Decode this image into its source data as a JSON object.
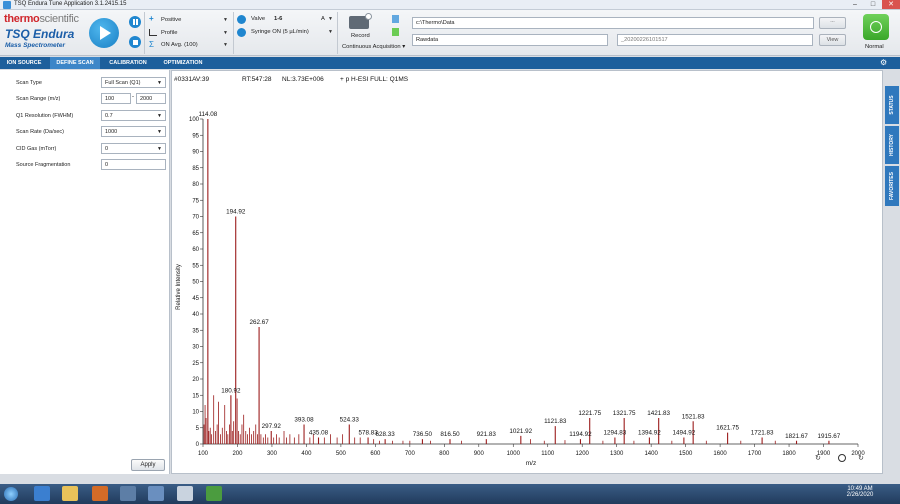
{
  "window": {
    "title": "TSQ Endura Tune Application 3.1.2415.15"
  },
  "brand": {
    "maker_red": "thermo",
    "maker_grey": "scientific",
    "product": "TSQ Endura",
    "subtitle": "Mass Spectrometer"
  },
  "toolbar": {
    "polarity": "Positive",
    "profile": "Profile",
    "averaging": "ON Avg. (100)",
    "valve_label": "Valve",
    "valve_value": "1-6",
    "valve_pos": "A",
    "syringe": "Syringe ON (5 µL/min)",
    "record_label": "Record",
    "acquisition_mode": "Continuous Acquisition",
    "data_path": "c:\\Thermo\\Data",
    "file_base": "Rawdata",
    "file_suffix": "_20200226101517",
    "browse_label": "...",
    "view_label": "View",
    "status_label": "Normal"
  },
  "tabs": [
    {
      "label": "ION SOURCE",
      "active": false
    },
    {
      "label": "DEFINE SCAN",
      "active": true
    },
    {
      "label": "CALIBRATION",
      "active": false
    },
    {
      "label": "OPTIMIZATION",
      "active": false
    }
  ],
  "scan_settings": {
    "scan_type_label": "Scan Type",
    "scan_type_value": "Full Scan (Q1)",
    "scan_range_label": "Scan Range (m/z)",
    "scan_range_from": "100",
    "scan_range_sep": "-",
    "scan_range_to": "2000",
    "q1_res_label": "Q1 Resolution (FWHM)",
    "q1_res_value": "0.7",
    "scan_rate_label": "Scan Rate (Da/sec)",
    "scan_rate_value": "1000",
    "cid_gas_label": "CID Gas (mTorr)",
    "cid_gas_value": "0",
    "source_frag_label": "Source Fragmentation",
    "source_frag_value": "0",
    "apply_label": "Apply"
  },
  "spectrum_header": {
    "scan": "#0331AV:39",
    "rt": "RT:547:28",
    "nl": "NL:3.73E+006",
    "filter": "+ p H-ESI FULL: Q1MS"
  },
  "side_tabs": [
    "STATUS",
    "HISTORY",
    "FAVORITES"
  ],
  "clock": {
    "time": "10:49 AM",
    "date": "2/26/2020"
  },
  "colors": {
    "accent": "#1d5f9c",
    "spectrum": "#9b1b1b",
    "normal_button": "#4cbb36"
  },
  "chart_data": {
    "type": "bar",
    "xlabel": "m/z",
    "ylabel": "Relative Intensity",
    "xlim": [
      100,
      2000
    ],
    "ylim": [
      0,
      100
    ],
    "x_ticks": [
      100,
      200,
      300,
      400,
      500,
      600,
      700,
      800,
      900,
      1000,
      1100,
      1200,
      1300,
      1400,
      1500,
      1600,
      1700,
      1800,
      1900,
      2000
    ],
    "y_ticks": [
      0,
      5,
      10,
      15,
      20,
      25,
      30,
      35,
      40,
      45,
      50,
      55,
      60,
      65,
      70,
      75,
      80,
      85,
      90,
      95,
      100
    ],
    "labeled_peaks": [
      {
        "mz": 114.08,
        "label": "114.08",
        "intensity": 100
      },
      {
        "mz": 194.92,
        "label": "194.92",
        "intensity": 70
      },
      {
        "mz": 262.67,
        "label": "262.67",
        "intensity": 36
      },
      {
        "mz": 180.92,
        "label": "180.92",
        "intensity": 15
      },
      {
        "mz": 297.92,
        "label": "297.92",
        "intensity": 4
      },
      {
        "mz": 393.08,
        "label": "393.08",
        "intensity": 6
      },
      {
        "mz": 435.08,
        "label": "435.08",
        "intensity": 2
      },
      {
        "mz": 524.33,
        "label": "524.33",
        "intensity": 6
      },
      {
        "mz": 578.83,
        "label": "578.83",
        "intensity": 2
      },
      {
        "mz": 628.33,
        "label": "628.33",
        "intensity": 1.5
      },
      {
        "mz": 736.5,
        "label": "736.50",
        "intensity": 1.5
      },
      {
        "mz": 816.5,
        "label": "816.50",
        "intensity": 1.5
      },
      {
        "mz": 921.83,
        "label": "921.83",
        "intensity": 1.5
      },
      {
        "mz": 1021.92,
        "label": "1021.92",
        "intensity": 2.5
      },
      {
        "mz": 1121.83,
        "label": "1121.83",
        "intensity": 5.5
      },
      {
        "mz": 1194.92,
        "label": "1194.92",
        "intensity": 1.5
      },
      {
        "mz": 1221.75,
        "label": "1221.75",
        "intensity": 8
      },
      {
        "mz": 1294.83,
        "label": "1294.83",
        "intensity": 2
      },
      {
        "mz": 1321.75,
        "label": "1321.75",
        "intensity": 8
      },
      {
        "mz": 1394.92,
        "label": "1394.92",
        "intensity": 2
      },
      {
        "mz": 1421.83,
        "label": "1421.83",
        "intensity": 8
      },
      {
        "mz": 1494.92,
        "label": "1494.92",
        "intensity": 2
      },
      {
        "mz": 1521.83,
        "label": "1521.83",
        "intensity": 7
      },
      {
        "mz": 1621.75,
        "label": "1621.75",
        "intensity": 3.5
      },
      {
        "mz": 1721.83,
        "label": "1721.83",
        "intensity": 2
      },
      {
        "mz": 1821.67,
        "label": "1821.67",
        "intensity": 1
      },
      {
        "mz": 1915.67,
        "label": "1915.67",
        "intensity": 1
      }
    ],
    "minor_peaks": [
      [
        103,
        6
      ],
      [
        106,
        12
      ],
      [
        109,
        8
      ],
      [
        117,
        4
      ],
      [
        121,
        5
      ],
      [
        125,
        3
      ],
      [
        131,
        15
      ],
      [
        136,
        4
      ],
      [
        141,
        6
      ],
      [
        145,
        13
      ],
      [
        151,
        3
      ],
      [
        156,
        5
      ],
      [
        163,
        12
      ],
      [
        168,
        4
      ],
      [
        172,
        3
      ],
      [
        177,
        6
      ],
      [
        185,
        4
      ],
      [
        189,
        7
      ],
      [
        199,
        14
      ],
      [
        203,
        4
      ],
      [
        208,
        3
      ],
      [
        213,
        6
      ],
      [
        218,
        9
      ],
      [
        224,
        4
      ],
      [
        229,
        3
      ],
      [
        235,
        5
      ],
      [
        241,
        3
      ],
      [
        247,
        4
      ],
      [
        253,
        6
      ],
      [
        258,
        3
      ],
      [
        268,
        3
      ],
      [
        275,
        2
      ],
      [
        281,
        3
      ],
      [
        288,
        2
      ],
      [
        305,
        2
      ],
      [
        313,
        3
      ],
      [
        321,
        2
      ],
      [
        335,
        4
      ],
      [
        342,
        2
      ],
      [
        352,
        3
      ],
      [
        365,
        2
      ],
      [
        378,
        3
      ],
      [
        410,
        2
      ],
      [
        420,
        3
      ],
      [
        452,
        2
      ],
      [
        470,
        3
      ],
      [
        489,
        2
      ],
      [
        505,
        3
      ],
      [
        540,
        2
      ],
      [
        556,
        2
      ],
      [
        595,
        1.5
      ],
      [
        612,
        1
      ],
      [
        650,
        1
      ],
      [
        680,
        1
      ],
      [
        700,
        1
      ],
      [
        760,
        1
      ],
      [
        850,
        1
      ],
      [
        1050,
        1.5
      ],
      [
        1090,
        1
      ],
      [
        1150,
        1.2
      ],
      [
        1260,
        1
      ],
      [
        1350,
        1
      ],
      [
        1460,
        1
      ],
      [
        1560,
        1
      ],
      [
        1660,
        1
      ],
      [
        1760,
        1
      ]
    ]
  }
}
